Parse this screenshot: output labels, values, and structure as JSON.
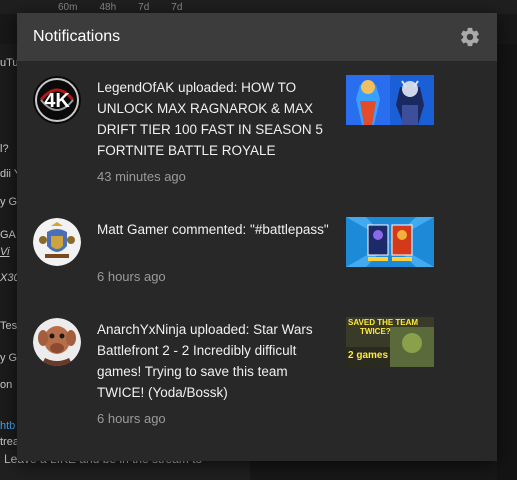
{
  "background": {
    "stats": [
      "60m",
      "48h",
      "7d",
      "7d"
    ],
    "fragments": [
      "uTu",
      "l?",
      "dii Y",
      "y G",
      "GA",
      "Vi",
      "X30",
      "Tes",
      "y G",
      "on",
      "htb",
      "trea",
      "Leave a LIKE and be in the stream to"
    ]
  },
  "panel": {
    "title": "Notifications",
    "settings_icon": "gear-icon"
  },
  "notifications": [
    {
      "text": "LegendOfAK uploaded: HOW TO UNLOCK MAX RAGNAROK & MAX DRIFT TIER 100 FAST IN SEASON 5 FORTNITE BATTLE ROYALE",
      "time": "43 minutes ago",
      "avatar": "4k-logo-avatar",
      "thumbnail": "fortnite-skins-thumbnail"
    },
    {
      "text": "Matt Gamer commented: \"#battlepass\"",
      "time": "6 hours ago",
      "avatar": "crest-avatar",
      "thumbnail": "battlepass-thumbnail"
    },
    {
      "text": "AnarchYxNinja uploaded: Star Wars Battlefront 2 - 2 Incredibly difficult games! Trying to save this team TWICE! (Yoda/Bossk)",
      "time": "6 hours ago",
      "avatar": "alien-character-avatar",
      "thumbnail": "saved-the-team-thumbnail",
      "thumbnail_text": [
        "SAVED THE TEAM",
        "TWICE?",
        "2 games"
      ]
    }
  ]
}
